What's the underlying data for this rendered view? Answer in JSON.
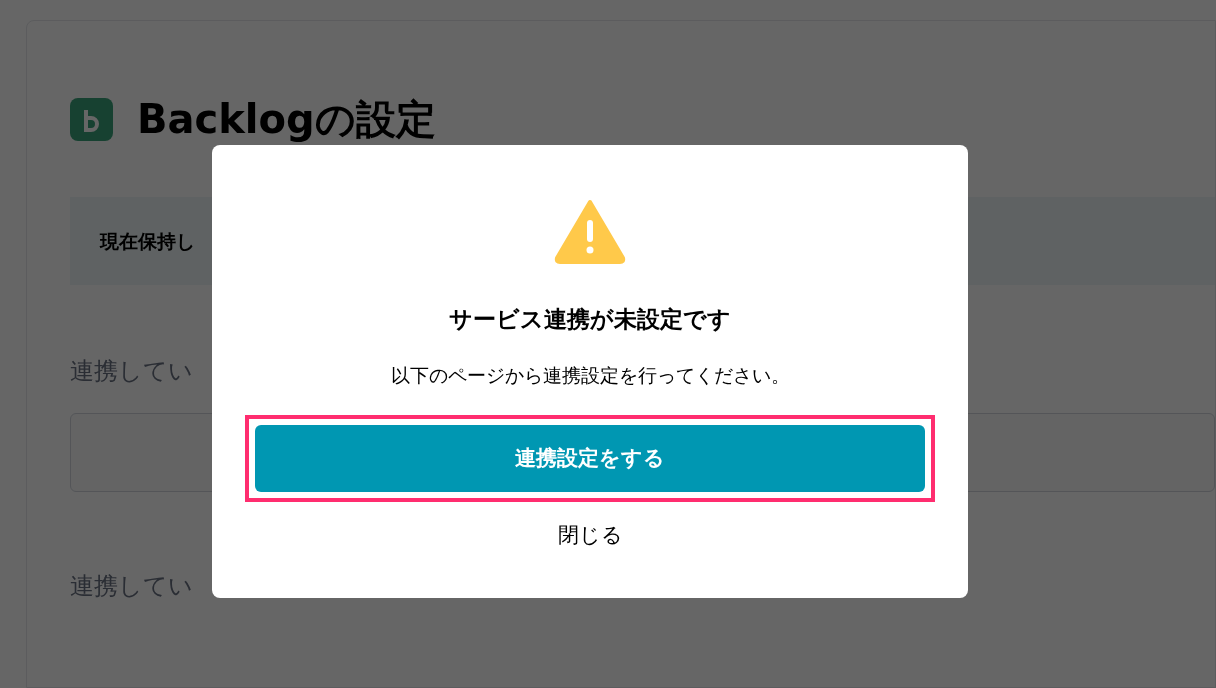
{
  "page": {
    "title": "Backlogの設定",
    "info_text": "現在保持し",
    "linked_label": "連携してい",
    "projects_label": "連携してい"
  },
  "dialog": {
    "title": "サービス連携が未設定です",
    "message": "以下のページから連携設定を行ってください。",
    "primary_button": {
      "label": "連携設定をする",
      "highlighted": true
    },
    "close_link": "閉じる"
  }
}
